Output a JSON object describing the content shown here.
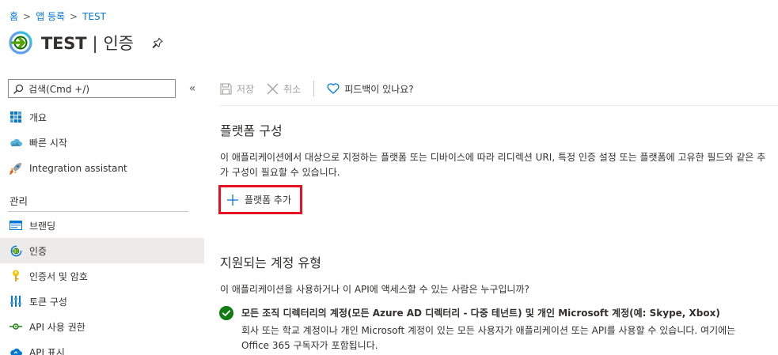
{
  "breadcrumb": {
    "items": [
      "홈",
      "앱 등록",
      "TEST"
    ],
    "separator": ">"
  },
  "header": {
    "app_name": "TEST",
    "divider": "|",
    "section": "인증",
    "pin_icon": "pin-icon"
  },
  "sidebar": {
    "search_placeholder": "검색(Cmd +/)",
    "collapse_glyph": "«",
    "items_top": [
      {
        "label": "개요",
        "icon": "grid-icon"
      },
      {
        "label": "빠른 시작",
        "icon": "cloud-icon"
      },
      {
        "label": "Integration assistant",
        "icon": "rocket-icon"
      }
    ],
    "section_label": "관리",
    "items_manage": [
      {
        "label": "브랜딩",
        "icon": "branding-icon"
      },
      {
        "label": "인증",
        "icon": "auth-icon",
        "active": true
      },
      {
        "label": "인증서 및 암호",
        "icon": "key-icon"
      },
      {
        "label": "토큰 구성",
        "icon": "token-icon"
      },
      {
        "label": "API 사용 권한",
        "icon": "api-permission-icon"
      },
      {
        "label": "API 표시",
        "icon": "cloud-api-icon"
      }
    ]
  },
  "toolbar": {
    "save_label": "저장",
    "cancel_label": "취소",
    "feedback_label": "피드백이 있나요?"
  },
  "platform": {
    "heading": "플랫폼 구성",
    "description_line1": "이 애플리케이션에서 대상으로 지정하는 플랫폼 또는 디바이스에 따라 리디렉션 URI, 특정 인증 설정 또는 플랫폼에 고유한 필드와 같은 추",
    "description_line2": "가 구성이 필요할 수 있습니다.",
    "add_label": "플랫폼 추가"
  },
  "accounts": {
    "heading": "지원되는 계정 유형",
    "question": "이 애플리케이션을 사용하거나 이 API에 액세스할 수 있는 사람은 누구입니까?",
    "option_title": "모든 조직 디렉터리의 계정(모든 Azure AD 디렉터리 - 다중 테넌트) 및 개인 Microsoft 계정(예: Skype, Xbox)",
    "option_desc_line1": "회사 또는 학교 계정이나 개인 Microsoft 계정이 있는 모든 사용자가 애플리케이션 또는 API를 사용할 수 있습니다. 여기에는",
    "option_desc_line2": "Office 365 구독자가 포함됩니다."
  },
  "colors": {
    "link": "#0078d4",
    "highlight_border": "#e81123",
    "check_green": "#107c10",
    "active_bg": "#edebe9"
  }
}
